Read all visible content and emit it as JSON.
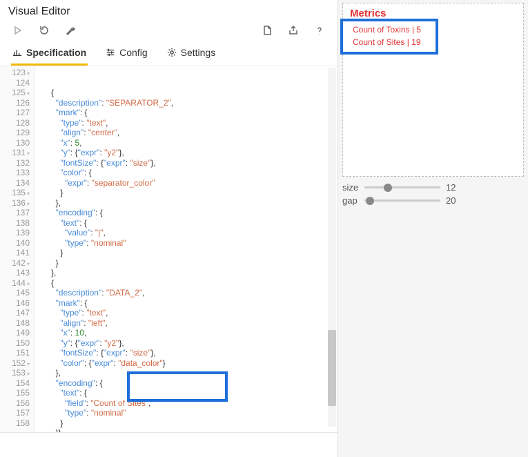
{
  "editor": {
    "title": "Visual Editor",
    "tabs": {
      "spec": "Specification",
      "config": "Config",
      "settings": "Settings"
    }
  },
  "metrics": {
    "title": "Metrics",
    "lines": [
      "Count of Toxins | 5",
      "Count of Sites | 19"
    ]
  },
  "sliders": {
    "size": {
      "label": "size",
      "value": "12",
      "pct": 25
    },
    "gap": {
      "label": "gap",
      "value": "20",
      "pct": 2
    }
  },
  "code_lines": [
    {
      "num": "123",
      "fold": true,
      "html": "      <span class='p'>{</span>"
    },
    {
      "num": "124",
      "fold": false,
      "html": "        <span class='k'>\"description\"</span><span class='p'>: </span><span class='s'>\"SEPARATOR_2\"</span><span class='p'>,</span>"
    },
    {
      "num": "125",
      "fold": true,
      "html": "        <span class='k'>\"mark\"</span><span class='p'>: {</span>"
    },
    {
      "num": "126",
      "fold": false,
      "html": "          <span class='k'>\"type\"</span><span class='p'>: </span><span class='s'>\"text\"</span><span class='p'>,</span>"
    },
    {
      "num": "127",
      "fold": false,
      "html": "          <span class='k'>\"align\"</span><span class='p'>: </span><span class='s'>\"center\"</span><span class='p'>,</span>"
    },
    {
      "num": "128",
      "fold": false,
      "html": "          <span class='k'>\"x\"</span><span class='p'>: </span><span class='n'>5</span><span class='p'>,</span>"
    },
    {
      "num": "129",
      "fold": false,
      "html": "          <span class='k'>\"y\"</span><span class='p'>: {</span><span class='k'>\"expr\"</span><span class='p'>: </span><span class='s'>\"y2\"</span><span class='p'>},</span>"
    },
    {
      "num": "130",
      "fold": false,
      "html": "          <span class='k'>\"fontSize\"</span><span class='p'>: {</span><span class='k'>\"expr\"</span><span class='p'>: </span><span class='s'>\"size\"</span><span class='p'>},</span>"
    },
    {
      "num": "131",
      "fold": true,
      "html": "          <span class='k'>\"color\"</span><span class='p'>: {</span>"
    },
    {
      "num": "132",
      "fold": false,
      "html": "            <span class='k'>\"expr\"</span><span class='p'>: </span><span class='s'>\"separator_color\"</span>"
    },
    {
      "num": "133",
      "fold": false,
      "html": "          <span class='p'>}</span>"
    },
    {
      "num": "134",
      "fold": false,
      "html": "        <span class='p'>},</span>"
    },
    {
      "num": "135",
      "fold": true,
      "html": "        <span class='k'>\"encoding\"</span><span class='p'>: {</span>"
    },
    {
      "num": "136",
      "fold": true,
      "html": "          <span class='k'>\"text\"</span><span class='p'>: {</span>"
    },
    {
      "num": "137",
      "fold": false,
      "html": "            <span class='k'>\"value\"</span><span class='p'>: </span><span class='s'>\"|\"</span><span class='p'>,</span>"
    },
    {
      "num": "138",
      "fold": false,
      "html": "            <span class='k'>\"type\"</span><span class='p'>: </span><span class='s'>\"nominal\"</span>"
    },
    {
      "num": "139",
      "fold": false,
      "html": "          <span class='p'>}</span>"
    },
    {
      "num": "140",
      "fold": false,
      "html": "        <span class='p'>}</span>"
    },
    {
      "num": "141",
      "fold": false,
      "html": "      <span class='p'>},</span>"
    },
    {
      "num": "142",
      "fold": true,
      "html": "      <span class='p'>{</span>"
    },
    {
      "num": "143",
      "fold": false,
      "html": "        <span class='k'>\"description\"</span><span class='p'>: </span><span class='s'>\"DATA_2\"</span><span class='p'>,</span>"
    },
    {
      "num": "144",
      "fold": true,
      "html": "        <span class='k'>\"mark\"</span><span class='p'>: {</span>"
    },
    {
      "num": "145",
      "fold": false,
      "html": "          <span class='k'>\"type\"</span><span class='p'>: </span><span class='s'>\"text\"</span><span class='p'>,</span>"
    },
    {
      "num": "146",
      "fold": false,
      "html": "          <span class='k'>\"align\"</span><span class='p'>: </span><span class='s'>\"left\"</span><span class='p'>,</span>"
    },
    {
      "num": "147",
      "fold": false,
      "html": "          <span class='k'>\"x\"</span><span class='p'>: </span><span class='n'>10</span><span class='p'>,</span>"
    },
    {
      "num": "148",
      "fold": false,
      "html": "          <span class='k'>\"y\"</span><span class='p'>: {</span><span class='k'>\"expr\"</span><span class='p'>: </span><span class='s'>\"y2\"</span><span class='p'>},</span>"
    },
    {
      "num": "149",
      "fold": false,
      "html": "          <span class='k'>\"fontSize\"</span><span class='p'>: {</span><span class='k'>\"expr\"</span><span class='p'>: </span><span class='s'>\"size\"</span><span class='p'>},</span>"
    },
    {
      "num": "150",
      "fold": false,
      "html": "          <span class='k'>\"color\"</span><span class='p'>: {</span><span class='k'>\"expr\"</span><span class='p'>: </span><span class='s'>\"data_color\"</span><span class='p'>}</span>"
    },
    {
      "num": "151",
      "fold": false,
      "html": "        <span class='p'>},</span>"
    },
    {
      "num": "152",
      "fold": true,
      "html": "        <span class='k'>\"encoding\"</span><span class='p'>: {</span>"
    },
    {
      "num": "153",
      "fold": true,
      "html": "          <span class='k'>\"text\"</span><span class='p'>: {</span>"
    },
    {
      "num": "154",
      "fold": false,
      "html": "            <span class='k'>\"field\"</span><span class='p'>: </span><span class='s'>\"Count of Sites\"</span><span class='p'>,</span>"
    },
    {
      "num": "155",
      "fold": false,
      "html": "            <span class='k'>\"type\"</span><span class='p'>: </span><span class='s'>\"nominal\"</span>"
    },
    {
      "num": "156",
      "fold": false,
      "html": "          <span class='p'>}</span>"
    },
    {
      "num": "157",
      "fold": false,
      "html": "        <span class='p'>}}</span>"
    },
    {
      "num": "158",
      "fold": false,
      "html": "      "
    }
  ]
}
